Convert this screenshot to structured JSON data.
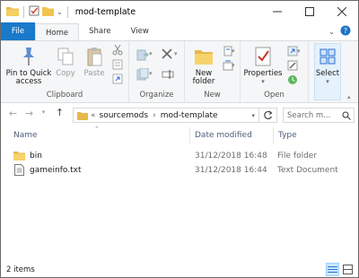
{
  "window": {
    "title": "mod-template"
  },
  "tabs": [
    {
      "label": "File"
    },
    {
      "label": "Home"
    },
    {
      "label": "Share"
    },
    {
      "label": "View"
    }
  ],
  "ribbon": {
    "clipboard": {
      "label": "Clipboard",
      "pin": "Pin to Quick access",
      "copy": "Copy",
      "paste": "Paste"
    },
    "organize": {
      "label": "Organize"
    },
    "new": {
      "label": "New",
      "new_folder": "New folder"
    },
    "open": {
      "label": "Open",
      "properties": "Properties"
    },
    "select": {
      "label": "Select"
    }
  },
  "address": {
    "path": [
      "sourcemods",
      "mod-template"
    ],
    "search_placeholder": "Search m..."
  },
  "columns": {
    "name": "Name",
    "date": "Date modified",
    "type": "Type"
  },
  "files": [
    {
      "name": "bin",
      "date": "31/12/2018 16:48",
      "type": "File folder",
      "icon": "folder-icon"
    },
    {
      "name": "gameinfo.txt",
      "date": "31/12/2018 16:44",
      "type": "Text Document",
      "icon": "text-file-icon"
    }
  ],
  "status": {
    "item_count": "2 items"
  },
  "colors": {
    "file_tab": "#1979ca",
    "folder": "#e8b84a",
    "selected_view": "#cce8ff"
  }
}
